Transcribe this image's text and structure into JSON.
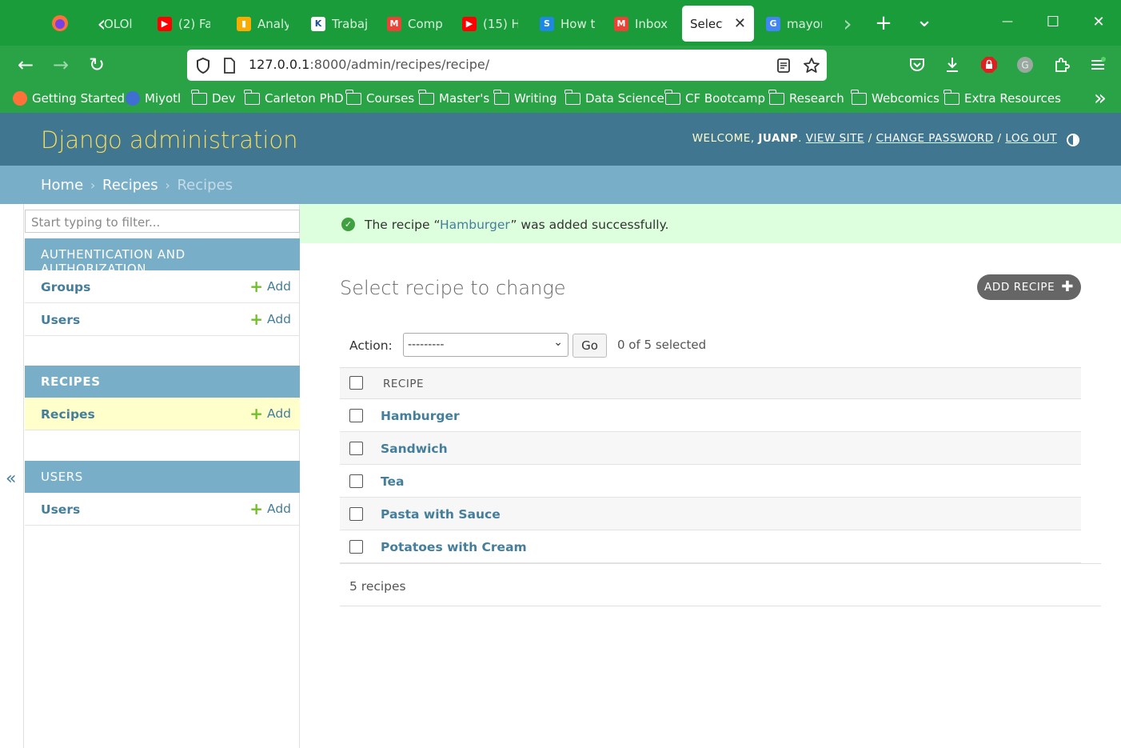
{
  "browser": {
    "tabs": [
      {
        "title": "OLOl",
        "color": "#e66000",
        "glyph": "●"
      },
      {
        "title": "(2) Fa",
        "color": "#ff0000",
        "glyph": "▶"
      },
      {
        "title": "Analy",
        "color": "#f9ab00",
        "glyph": "▮"
      },
      {
        "title": "Trabaj",
        "color": "#ffffff",
        "glyph": "K"
      },
      {
        "title": "Comp",
        "color": "#ea4335",
        "glyph": "M"
      },
      {
        "title": "(15) H",
        "color": "#ff0000",
        "glyph": "▶"
      },
      {
        "title": "How t",
        "color": "#1e88e5",
        "glyph": "S"
      },
      {
        "title": "Inbox",
        "color": "#ea4335",
        "glyph": "M"
      },
      {
        "title": "mayor",
        "color": "#4285f4",
        "glyph": "G"
      }
    ],
    "active_tab": {
      "title": "Select r",
      "close": "✕"
    },
    "url": {
      "host": "127.0.0.1",
      "rest": ":8000/admin/recipes/recipe/"
    },
    "bookmarks": [
      "Getting Started",
      "Miyotl",
      "Dev",
      "Carleton PhD",
      "Courses",
      "Master's",
      "Writing",
      "Data Science",
      "CF Bootcamp",
      "Research",
      "Webcomics",
      "Extra Resources"
    ],
    "icons": {
      "back": "←",
      "forward": "→",
      "reload": "↻",
      "more": "»",
      "new_tab": "+",
      "list_all": "⌄",
      "minimize": "—",
      "maximize": "☐",
      "close": "✕",
      "scroll_left": "‹",
      "scroll_right": "›"
    }
  },
  "admin": {
    "brand": "Django administration",
    "welcome": "Welcome,",
    "username": "juanp",
    "view_site": "View site",
    "change_password": "Change password",
    "log_out": "Log out",
    "breadcrumbs": {
      "home": "Home",
      "app": "Recipes",
      "current": "Recipes",
      "sep": "›"
    },
    "sidebar": {
      "filter_placeholder": "Start typing to filter...",
      "modules": [
        {
          "caption": "Authentication and Authorization",
          "models": [
            {
              "name": "Groups",
              "add": "Add"
            },
            {
              "name": "Users",
              "add": "Add"
            }
          ]
        },
        {
          "caption": "Recipes",
          "models": [
            {
              "name": "Recipes",
              "add": "Add"
            }
          ]
        },
        {
          "caption": "Users",
          "models": [
            {
              "name": "Users",
              "add": "Add"
            }
          ]
        }
      ],
      "collapse": "«"
    },
    "message": {
      "before": "The recipe “",
      "link": "Hamburger",
      "after": "” was added successfully."
    },
    "title": "Select recipe to change",
    "add_button": "Add recipe",
    "actions": {
      "label": "Action:",
      "selected": "---------",
      "go": "Go",
      "counter": "0 of 5 selected"
    },
    "table": {
      "header": "Recipe",
      "rows": [
        "Hamburger",
        "Sandwich",
        "Tea",
        "Pasta with Sauce",
        "Potatoes with Cream"
      ]
    },
    "paginator": "5 recipes",
    "colors": {
      "header": "#417690",
      "brand": "#f5dd5d",
      "breadcrumbs": "#79aec8",
      "link": "#447e9b",
      "success": "#ddffdd",
      "browser": "#1b9c3a"
    }
  }
}
